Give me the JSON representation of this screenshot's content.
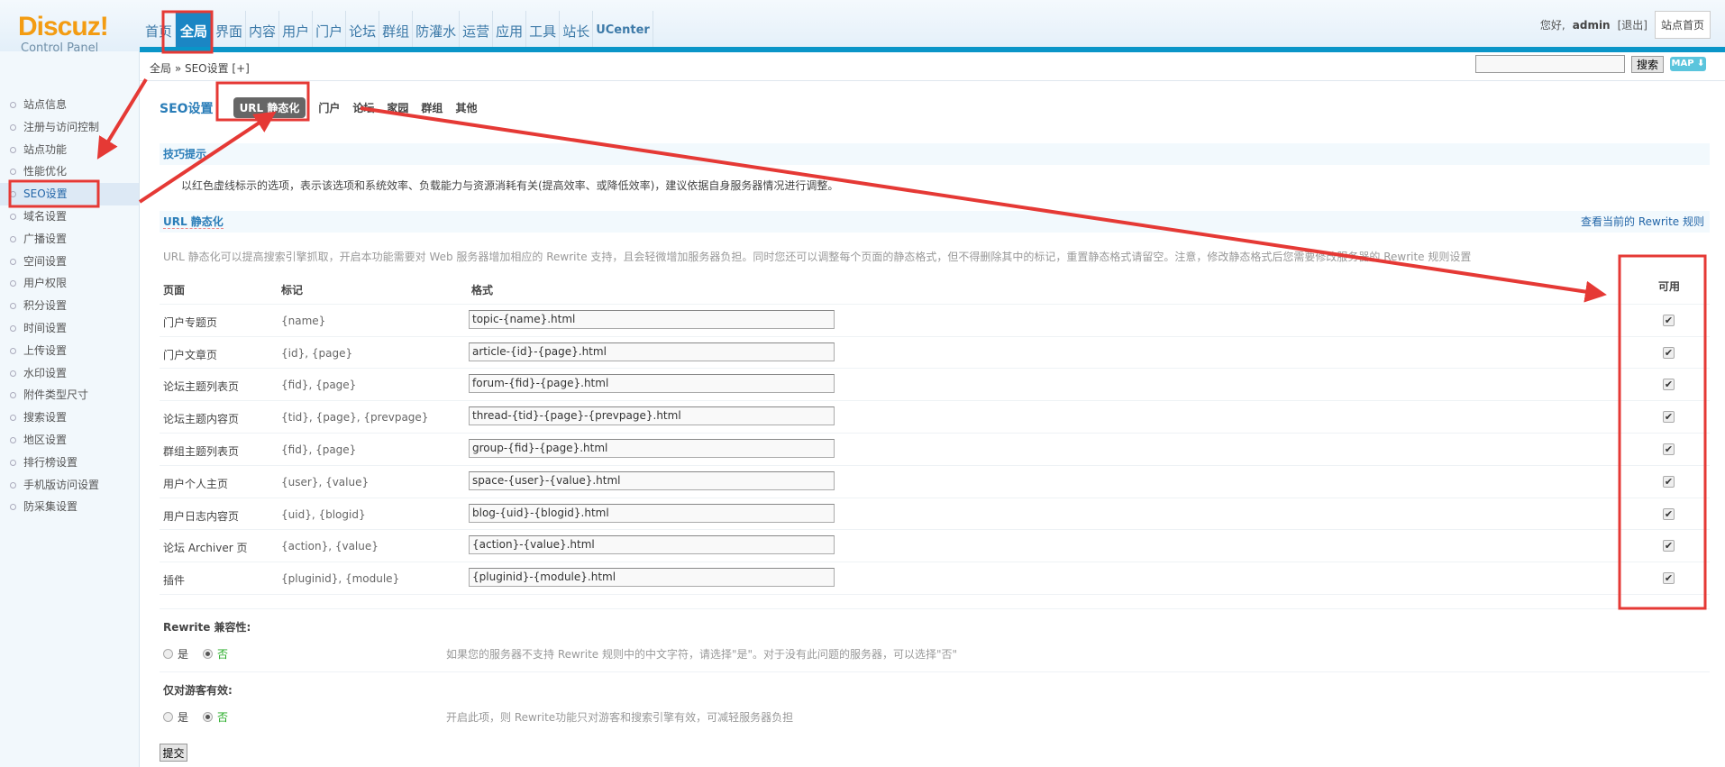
{
  "header": {
    "logo": "Discuz!",
    "logo_sub": "Control Panel",
    "nav": [
      "首页",
      "全局",
      "界面",
      "内容",
      "用户",
      "门户",
      "论坛",
      "群组",
      "防灌水",
      "运营",
      "应用",
      "工具",
      "站长",
      "UCenter"
    ],
    "active_nav": 1,
    "greeting": "您好,",
    "username": "admin",
    "logout": "[退出]",
    "site_home": "站点首页"
  },
  "breadcrumb": "全局 » SEO设置  [+]",
  "search": {
    "value": "",
    "button": "搜索",
    "map": "MAP ⬇"
  },
  "sidebar": {
    "items": [
      "站点信息",
      "注册与访问控制",
      "站点功能",
      "性能优化",
      "SEO设置",
      "域名设置",
      "广播设置",
      "空间设置",
      "用户权限",
      "积分设置",
      "时间设置",
      "上传设置",
      "水印设置",
      "附件类型尺寸",
      "搜索设置",
      "地区设置",
      "排行榜设置",
      "手机版访问设置",
      "防采集设置"
    ],
    "active": 4
  },
  "main": {
    "title": "SEO设置",
    "tabs": [
      "URL 静态化",
      "门户",
      "论坛",
      "家园",
      "群组",
      "其他"
    ],
    "tip_title": "技巧提示",
    "tip_text": "以红色虚线标示的选项，表示该选项和系统效率、负载能力与资源消耗有关(提高效率、或降低效率)，建议依据自身服务器情况进行调整。",
    "section_title": "URL 静态化",
    "rewrite_link": "查看当前的 Rewrite 规则",
    "description": "URL 静态化可以提高搜索引擎抓取，开启本功能需要对 Web 服务器增加相应的 Rewrite 支持，且会轻微增加服务器负担。同时您还可以调整每个页面的静态格式，但不得删除其中的标记，重置静态格式请留空。注意，修改静态格式后您需要修改服务器的 Rewrite 规则设置",
    "columns": [
      "页面",
      "标记",
      "格式",
      "可用"
    ],
    "rows": [
      {
        "page": "门户专题页",
        "mark": "{name}",
        "format": "topic-{name}.html",
        "enabled": true
      },
      {
        "page": "门户文章页",
        "mark": "{id}, {page}",
        "format": "article-{id}-{page}.html",
        "enabled": true
      },
      {
        "page": "论坛主题列表页",
        "mark": "{fid}, {page}",
        "format": "forum-{fid}-{page}.html",
        "enabled": true
      },
      {
        "page": "论坛主题内容页",
        "mark": "{tid}, {page}, {prevpage}",
        "format": "thread-{tid}-{page}-{prevpage}.html",
        "enabled": true
      },
      {
        "page": "群组主题列表页",
        "mark": "{fid}, {page}",
        "format": "group-{fid}-{page}.html",
        "enabled": true
      },
      {
        "page": "用户个人主页",
        "mark": "{user}, {value}",
        "format": "space-{user}-{value}.html",
        "enabled": true
      },
      {
        "page": "用户日志内容页",
        "mark": "{uid}, {blogid}",
        "format": "blog-{uid}-{blogid}.html",
        "enabled": true
      },
      {
        "page": "论坛 Archiver 页",
        "mark": "{action}, {value}",
        "format": "{action}-{value}.html",
        "enabled": true
      },
      {
        "page": "插件",
        "mark": "{pluginid}, {module}",
        "format": "{pluginid}-{module}.html",
        "enabled": true
      }
    ],
    "options": [
      {
        "label": "Rewrite 兼容性:",
        "yes": "是",
        "no": "否",
        "selected": "否",
        "help": "如果您的服务器不支持 Rewrite 规则中的中文字符，请选择\"是\"。对于没有此问题的服务器，可以选择\"否\""
      },
      {
        "label": "仅对游客有效:",
        "yes": "是",
        "no": "否",
        "selected": "否",
        "help": "开启此项，则 Rewrite功能只对游客和搜索引擎有效，可减轻服务器负担"
      }
    ],
    "submit": "提交"
  },
  "annotation_color": "#e53935"
}
